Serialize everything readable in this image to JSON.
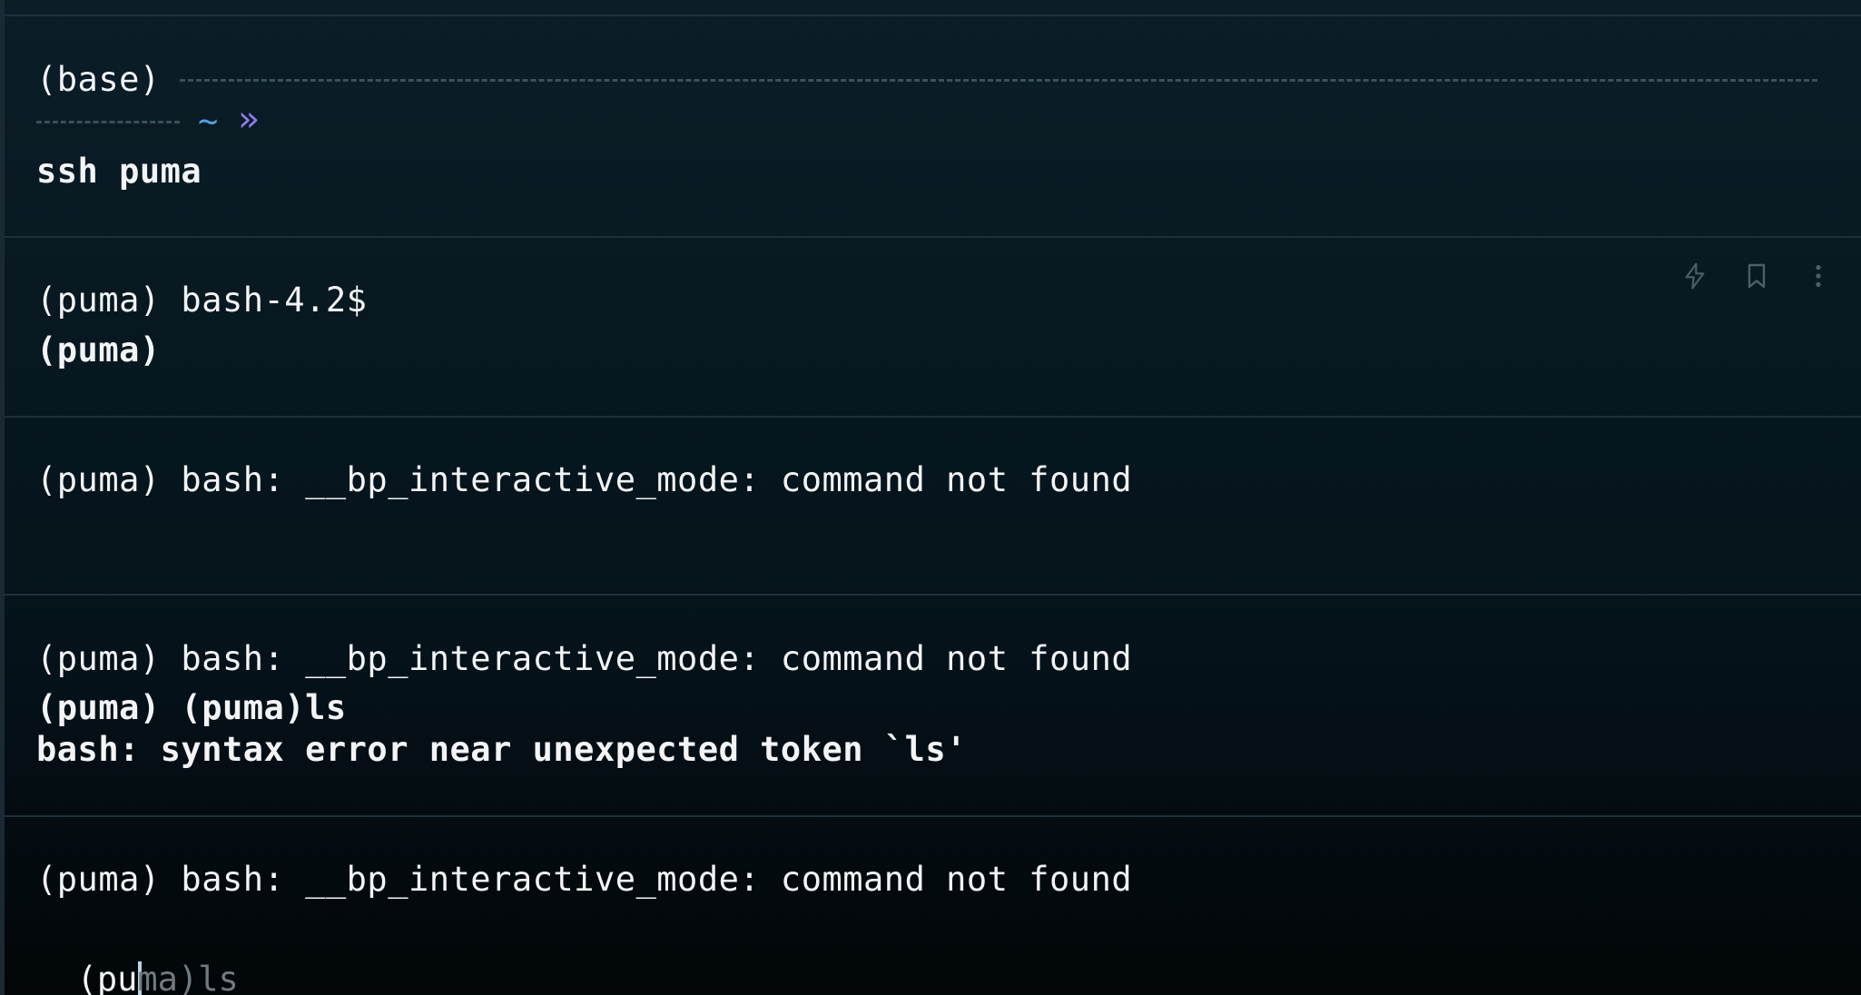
{
  "blocks": [
    {
      "prompt_env": "(base)",
      "prompt_dir": "~",
      "prompt_symbol": "»",
      "command": "ssh puma"
    },
    {
      "output_lines": [
        "(puma) bash-4.2$"
      ],
      "bold_lines": [
        "(puma)"
      ]
    },
    {
      "output_lines": [
        "(puma) bash: __bp_interactive_mode: command not found"
      ]
    },
    {
      "output_lines": [
        "(puma) bash: __bp_interactive_mode: command not found"
      ],
      "bold_lines": [
        "(puma) (puma)ls",
        "bash: syntax error near unexpected token `ls'"
      ]
    },
    {
      "output_lines": [
        "(puma) bash: __bp_interactive_mode: command not found"
      ]
    }
  ],
  "input": {
    "typed_prefix": "(",
    "typed_underlined": "pu",
    "suggestion": "ma)ls"
  },
  "block_actions": {
    "icons": [
      "lightning-icon",
      "bookmark-icon",
      "more-vertical-icon"
    ]
  },
  "colors": {
    "background": "#071820",
    "dashes": "#39505b",
    "dir": "#4aa3e8",
    "prompt_symbol": "#8f7cf0",
    "suggestion": "#6f7b80",
    "spell_error": "#d9534f"
  }
}
